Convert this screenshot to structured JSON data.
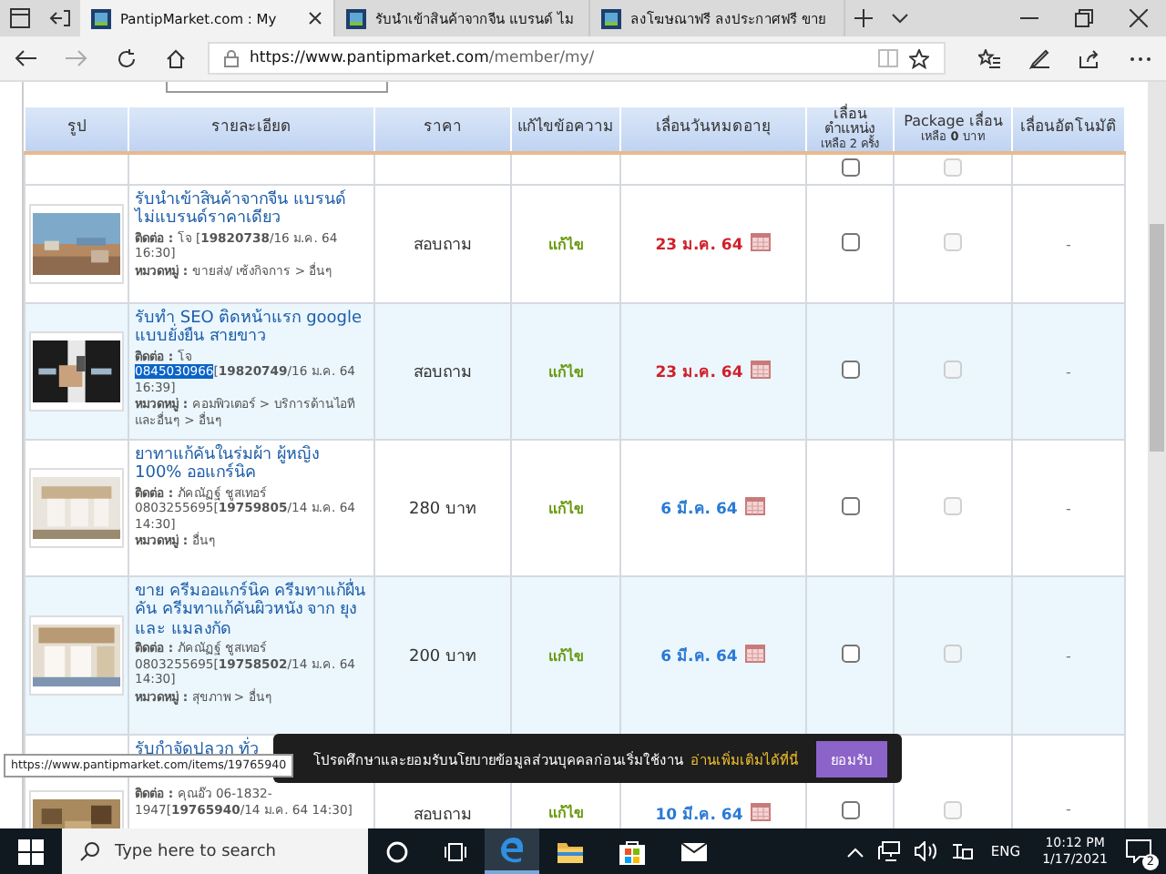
{
  "browser": {
    "tabs": [
      {
        "title": "PantipMarket.com : My",
        "selected": true
      },
      {
        "title": "รับนำเข้าสินค้าจากจีน แบรนด์ ไม",
        "selected": false
      },
      {
        "title": "ลงโฆษณาฟรี ลงประกาศฟรี ขาย",
        "selected": false
      }
    ],
    "address_host": "https://www.pantipmarket.com",
    "address_path": "/member/my/"
  },
  "table": {
    "columns": [
      {
        "label": "รูป"
      },
      {
        "label": "รายละเอียด"
      },
      {
        "label": "ราคา"
      },
      {
        "label": "แก้ไขข้อความ"
      },
      {
        "label": "เลื่อนวันหมดอายุ"
      },
      {
        "label": "เลื่อนตำแหน่ง",
        "sub": "เหลือ 2 ครั้ง"
      },
      {
        "label": "Package เลื่อน",
        "sub": "เหลือ **0** บาท"
      },
      {
        "label": "เลื่อนอัตโนมัติ"
      }
    ],
    "top_row": {
      "bump_checked": false,
      "package_disabled": true
    },
    "rows": [
      {
        "title": "รับนำเข้าสินค้าจากจีน แบรนด์ ไม่แบรนด์ราคาเดียว",
        "contact_before": "**ติดต่อ :** โจ",
        "contact_after": "[**19820738**/16 ม.ค. 64 16:30]",
        "category": "**หมวดหมู่ :** ขายส่ง/ เซ้งกิจการ > อื่นๆ",
        "price": "สอบถาม",
        "edit": "แก้ไข",
        "expiry": "23 ม.ค. 64",
        "urgent": true,
        "bump_checked": false,
        "package_disabled": true,
        "auto": "-"
      },
      {
        "title": "รับทำ SEO ติดหน้าแรก google แบบยั่งยืน สายขาว",
        "contact_before": "**ติดต่อ :** โจ",
        "phone": "0845030966",
        "phone_selected": true,
        "contact_after": "[**19820749**/16 ม.ค. 64 16:39]",
        "category": "**หมวดหมู่ :** คอมพิวเตอร์ > บริการด้านไอทีและอื่นๆ > อื่นๆ",
        "price": "สอบถาม",
        "edit": "แก้ไข",
        "expiry": "23 ม.ค. 64",
        "urgent": true,
        "bump_checked": false,
        "package_disabled": true,
        "auto": "-"
      },
      {
        "title": "ยาทาแก้คันในร่มผ้า ผู้หญิง 100% ออแกร์นิค",
        "contact_before": "**ติดต่อ :** ภัคณัฏฐ์ ชูสเทอร์",
        "phone": "0803255695",
        "phone_selected": false,
        "contact_after": "[**19759805**/14 ม.ค. 64 14:30]",
        "category": "**หมวดหมู่ :** อื่นๆ",
        "price": "280 บาท",
        "edit": "แก้ไข",
        "expiry": "6 มี.ค. 64",
        "urgent": false,
        "bump_checked": false,
        "package_disabled": true,
        "auto": "-"
      },
      {
        "title": "ขาย ครีมออแกร์นิค ครีมทาแก้ผื่นคัน ครีมทาแก้คันผิวหนัง จาก ยุง และ แมลงกัด",
        "contact_before": "**ติดต่อ :** ภัคณัฏฐ์ ชูสเทอร์",
        "phone": "0803255695",
        "phone_selected": false,
        "contact_after": "[**19758502**/14 ม.ค. 64 14:30]",
        "category": "**หมวดหมู่ :** สุขภาพ > อื่นๆ",
        "price": "200 บาท",
        "edit": "แก้ไข",
        "expiry": "6 มี.ค. 64",
        "urgent": false,
        "bump_checked": false,
        "package_disabled": true,
        "auto": "-"
      },
      {
        "title": "รับกำจัดปลวก ทั่ว",
        "contact_before": "**ติดต่อ :** คุณอ๊ว",
        "phone": "06-1832-1947",
        "phone_selected": false,
        "contact_after": "[**19765940**/14 ม.ค. 64 14:30]",
        "price": "สอบถาม",
        "edit": "แก้ไข",
        "expiry": "10 มี.ค. 64",
        "urgent": false,
        "bump_checked": false,
        "package_disabled": true,
        "auto": "-"
      }
    ]
  },
  "link_tooltip": "https://www.pantipmarket.com/items/19765940",
  "cookie_banner": {
    "message": "โปรดศึกษาและยอมรับนโยบายข้อมูลส่วนบุคคลก่อนเริ่มใช้งาน",
    "link": "อ่านเพิ่มเติมได้ที่นี่",
    "button": "ยอมรับ"
  },
  "taskbar": {
    "search_placeholder": "Type here to search",
    "language": "ENG",
    "time": "10:12 PM",
    "date": "1/17/2021",
    "notifications": "2"
  }
}
